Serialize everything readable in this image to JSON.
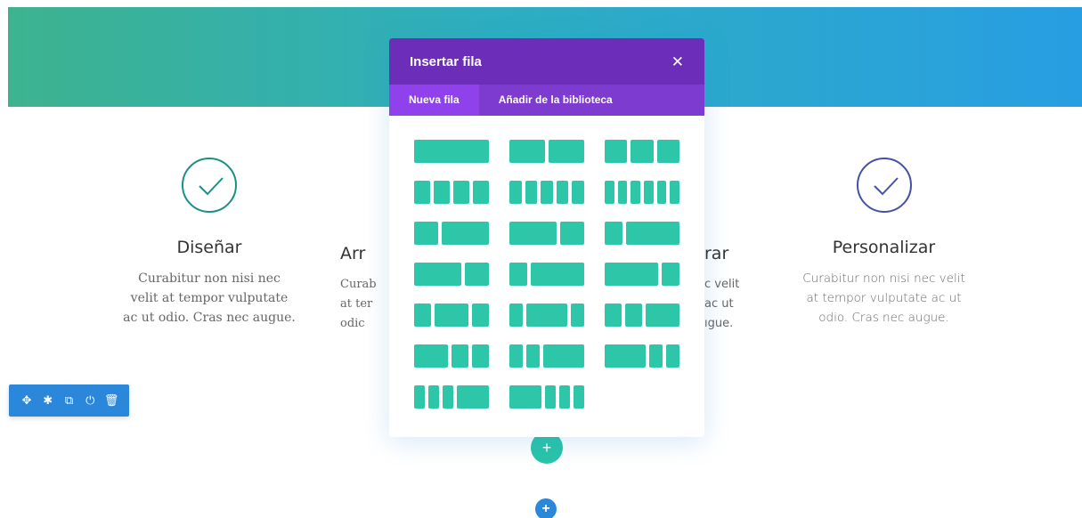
{
  "features": [
    {
      "title": "Diseñar",
      "text": [
        "Curabitur non nisi nec",
        "velit at tempor vulputate",
        "ac ut odio. Cras nec augue."
      ],
      "icon": "check-circle-icon"
    },
    {
      "title": "Personalizar",
      "text": [
        "Curabitur non nisi nec velit",
        "at tempor vulputate ac ut",
        "odio. Cras nec augue."
      ],
      "icon": "check-circle-icon"
    }
  ],
  "partial_left": {
    "title": "Arr",
    "text": [
      "Curab",
      "at ter",
      "odic"
    ]
  },
  "partial_right": {
    "title": "rar",
    "text": [
      "c velit",
      "ac ut",
      "ıgue."
    ]
  },
  "row_toolbar": {
    "icons": [
      "move-icon",
      "settings-icon",
      "duplicate-icon",
      "toggle-icon",
      "delete-icon"
    ],
    "glyphs": [
      "✥",
      "✱",
      "⧉",
      "⏻",
      "🗑"
    ]
  },
  "add_buttons": {
    "module": "+",
    "row": "+"
  },
  "modal": {
    "title": "Insertar fila",
    "close": "✕",
    "tabs": [
      {
        "label": "Nueva fila",
        "active": true
      },
      {
        "label": "Añadir de la biblioteca",
        "active": false
      }
    ],
    "layouts": [
      [
        1
      ],
      [
        1,
        1
      ],
      [
        1,
        1,
        1
      ],
      [
        1,
        1,
        1,
        1
      ],
      [
        1,
        1,
        1,
        1,
        1
      ],
      [
        1,
        1,
        1,
        1,
        1,
        1
      ],
      [
        1,
        2
      ],
      [
        2,
        1
      ],
      [
        1,
        3
      ],
      [
        2,
        1
      ],
      [
        1,
        3
      ],
      [
        3,
        1
      ],
      [
        1,
        2,
        1
      ],
      [
        1,
        3,
        1
      ],
      [
        1,
        1,
        2
      ],
      [
        2,
        1,
        1
      ],
      [
        1,
        1,
        3
      ],
      [
        3,
        1,
        1
      ],
      [
        1,
        1,
        1,
        3
      ],
      [
        3,
        1,
        1,
        1
      ]
    ]
  },
  "colors": {
    "accent": "#2dc6a8",
    "modal_header": "#6c2eb9",
    "modal_tabs": "#7e3bd0",
    "toolbar": "#2b87da"
  }
}
